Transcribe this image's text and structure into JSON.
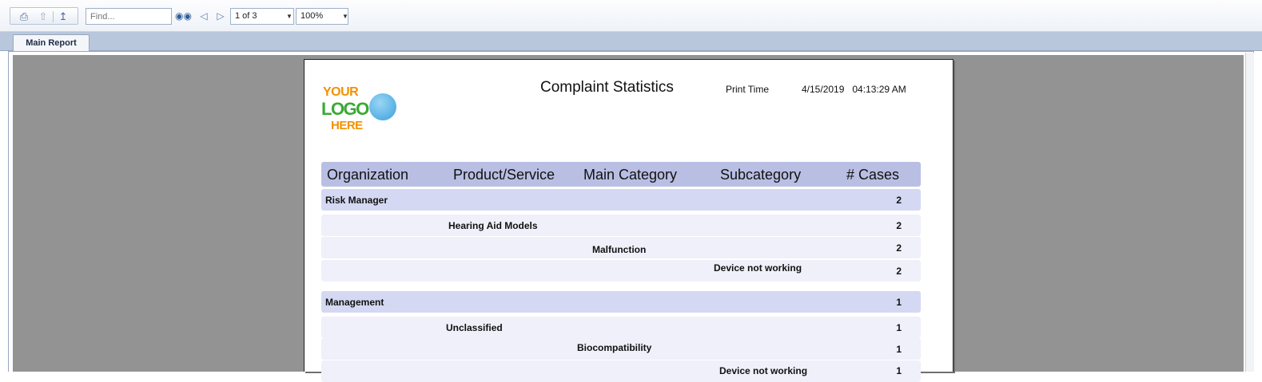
{
  "toolbar": {
    "find_placeholder": "Find...",
    "page_indicator": "1 of 3",
    "zoom": "100%",
    "icons": [
      "printer-icon",
      "export-up-icon",
      "export-icon",
      "binoculars-icon",
      "previous-page-icon",
      "next-page-icon"
    ]
  },
  "tabs": [
    {
      "label": "Main Report"
    }
  ],
  "report": {
    "logo": {
      "line1": "YOUR",
      "line2": "LOGO",
      "line3": "HERE"
    },
    "title": "Complaint Statistics",
    "print_time_label": "Print Time",
    "print_time_value": "4/15/2019   04:13:29 AM",
    "columns": [
      "Organization",
      "Product/Service",
      "Main Category",
      "Subcategory",
      "# Cases"
    ],
    "rows": [
      {
        "level": "organization",
        "text": "Risk Manager",
        "count": "2"
      },
      {
        "level": "product",
        "text": "Hearing Aid Models",
        "count": "2"
      },
      {
        "level": "main_category",
        "text": "Malfunction",
        "count": "2"
      },
      {
        "level": "subcategory",
        "text": "Device not working",
        "count": "2"
      },
      {
        "level": "organization",
        "text": "Management",
        "count": "1"
      },
      {
        "level": "product",
        "text": "Unclassified",
        "count": "1"
      },
      {
        "level": "main_category",
        "text": "Biocompatibility",
        "count": "1"
      },
      {
        "level": "subcategory",
        "text": "Device not working",
        "count": "1"
      }
    ]
  }
}
